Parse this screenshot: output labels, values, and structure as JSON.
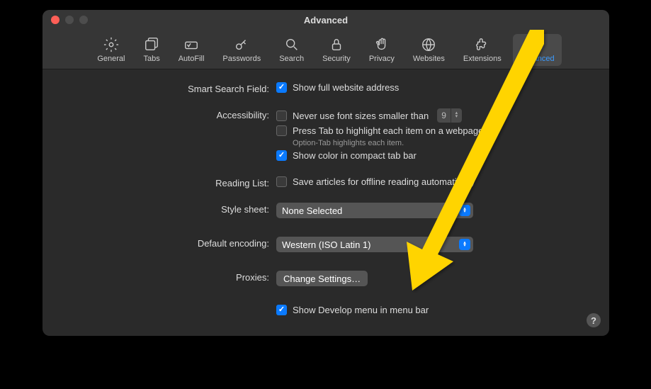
{
  "window": {
    "title": "Advanced"
  },
  "toolbar": {
    "items": [
      {
        "label": "General"
      },
      {
        "label": "Tabs"
      },
      {
        "label": "AutoFill"
      },
      {
        "label": "Passwords"
      },
      {
        "label": "Search"
      },
      {
        "label": "Security"
      },
      {
        "label": "Privacy"
      },
      {
        "label": "Websites"
      },
      {
        "label": "Extensions"
      },
      {
        "label": "Advanced"
      }
    ]
  },
  "labels": {
    "smart_search": "Smart Search Field:",
    "accessibility": "Accessibility:",
    "reading_list": "Reading List:",
    "style_sheet": "Style sheet:",
    "default_encoding": "Default encoding:",
    "proxies": "Proxies:"
  },
  "options": {
    "show_full_url": "Show full website address",
    "never_font_sizes": "Never use font sizes smaller than",
    "font_size_value": "9",
    "press_tab": "Press Tab to highlight each item on a webpage",
    "option_tab_hint": "Option-Tab highlights each item.",
    "show_color_compact": "Show color in compact tab bar",
    "save_offline": "Save articles for offline reading automatically",
    "style_sheet_value": "None Selected",
    "encoding_value": "Western (ISO Latin 1)",
    "change_settings": "Change Settings…",
    "show_develop": "Show Develop menu in menu bar"
  },
  "help": "?"
}
